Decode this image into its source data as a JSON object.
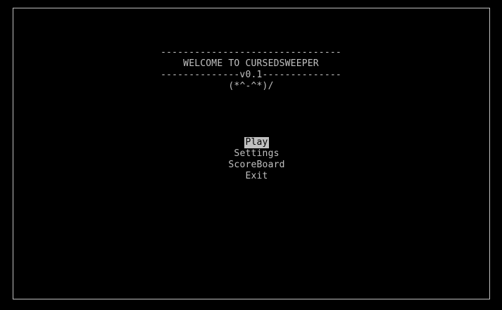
{
  "colors": {
    "background": "#000000",
    "foreground": "#c0c0c0",
    "selected_bg": "#c0c0c0",
    "selected_fg": "#000000"
  },
  "header": {
    "rule_top": "--------------------------------",
    "title": "WELCOME TO CURSEDSWEEPER",
    "rule_version": "--------------v0.1--------------",
    "emoticon": "(*^-^*)/"
  },
  "menu": {
    "selected_index": 0,
    "items": [
      {
        "label": "Play"
      },
      {
        "label": "Settings"
      },
      {
        "label": "ScoreBoard"
      },
      {
        "label": "Exit"
      }
    ]
  }
}
